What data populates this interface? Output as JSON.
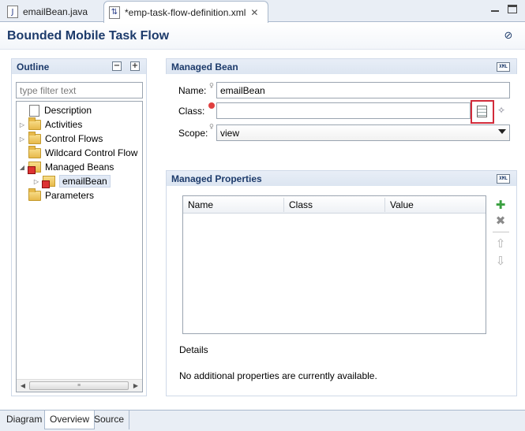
{
  "tabs": [
    {
      "label": "emailBean.java",
      "icon": "java-file-icon"
    },
    {
      "label": "*emp-task-flow-definition.xml",
      "icon": "task-flow-icon"
    }
  ],
  "page_title": "Bounded Mobile Task Flow",
  "outline": {
    "title": "Outline",
    "filter_placeholder": "type filter text",
    "items": [
      {
        "label": "Description",
        "expanded": null
      },
      {
        "label": "Activities",
        "expanded": false
      },
      {
        "label": "Control Flows",
        "expanded": false
      },
      {
        "label": "Wildcard Control Flow",
        "expanded": null
      },
      {
        "label": "Managed Beans",
        "expanded": true
      },
      {
        "label": "emailBean",
        "expanded": false,
        "selected": true
      },
      {
        "label": "Parameters",
        "expanded": null
      }
    ]
  },
  "managed_bean": {
    "title": "Managed Bean",
    "name_label": "Name:",
    "name_value": "emailBean",
    "class_label": "Class:",
    "class_value": "",
    "scope_label": "Scope:",
    "scope_value": "view"
  },
  "managed_properties": {
    "title": "Managed Properties",
    "columns": [
      "Name",
      "Class",
      "Value"
    ],
    "rows": [],
    "details_label": "Details",
    "details_text": "No additional properties are currently available."
  },
  "bottom_tabs": [
    "Diagram",
    "Overview",
    "Source"
  ],
  "active_bottom_tab": "Overview",
  "colors": {
    "title": "#1d3b6b",
    "highlight": "#d22b3a",
    "add": "#3aa040"
  }
}
